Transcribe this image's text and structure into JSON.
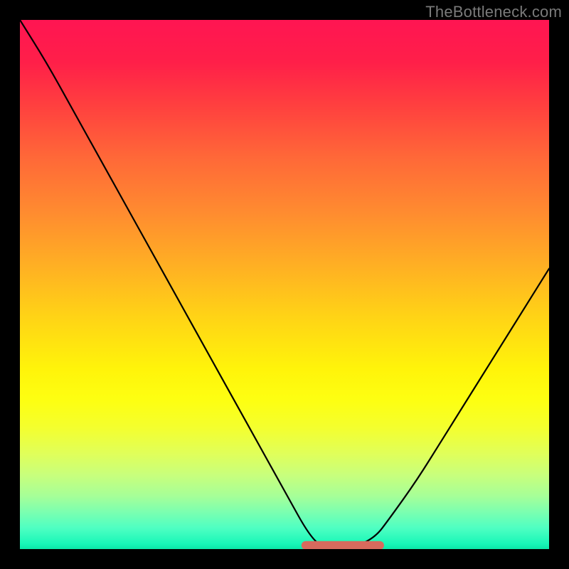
{
  "watermark": "TheBottleneck.com",
  "chart_data": {
    "type": "line",
    "title": "",
    "xlabel": "",
    "ylabel": "",
    "xlim": [
      0,
      100
    ],
    "ylim": [
      0,
      100
    ],
    "grid": false,
    "legend": false,
    "description": "Bottleneck percentage curve over a red-to-green vertical gradient. Curve is high (large bottleneck) at low x, drops to a near-zero flat minimum around x≈55–67, then rises again toward high x. Flat minimum segment is highlighted by a thick salmon band indicating recommended fit range.",
    "series": [
      {
        "name": "bottleneck_curve",
        "x": [
          0,
          5,
          10,
          15,
          20,
          25,
          30,
          35,
          40,
          45,
          50,
          55,
          58,
          62,
          67,
          70,
          75,
          80,
          85,
          90,
          95,
          100
        ],
        "values": [
          100,
          92,
          83,
          74,
          65,
          56,
          47,
          38,
          29,
          20,
          11,
          2,
          0,
          0,
          2,
          6,
          13,
          21,
          29,
          37,
          45,
          53
        ]
      }
    ],
    "fit_band": {
      "x_start": 54,
      "x_end": 68,
      "y": 0.7
    },
    "gradient_stops": [
      {
        "pct": 0,
        "color": "#ff1552"
      },
      {
        "pct": 50,
        "color": "#ffd316"
      },
      {
        "pct": 78,
        "color": "#f4ff2e"
      },
      {
        "pct": 100,
        "color": "#0be7a8"
      }
    ]
  }
}
